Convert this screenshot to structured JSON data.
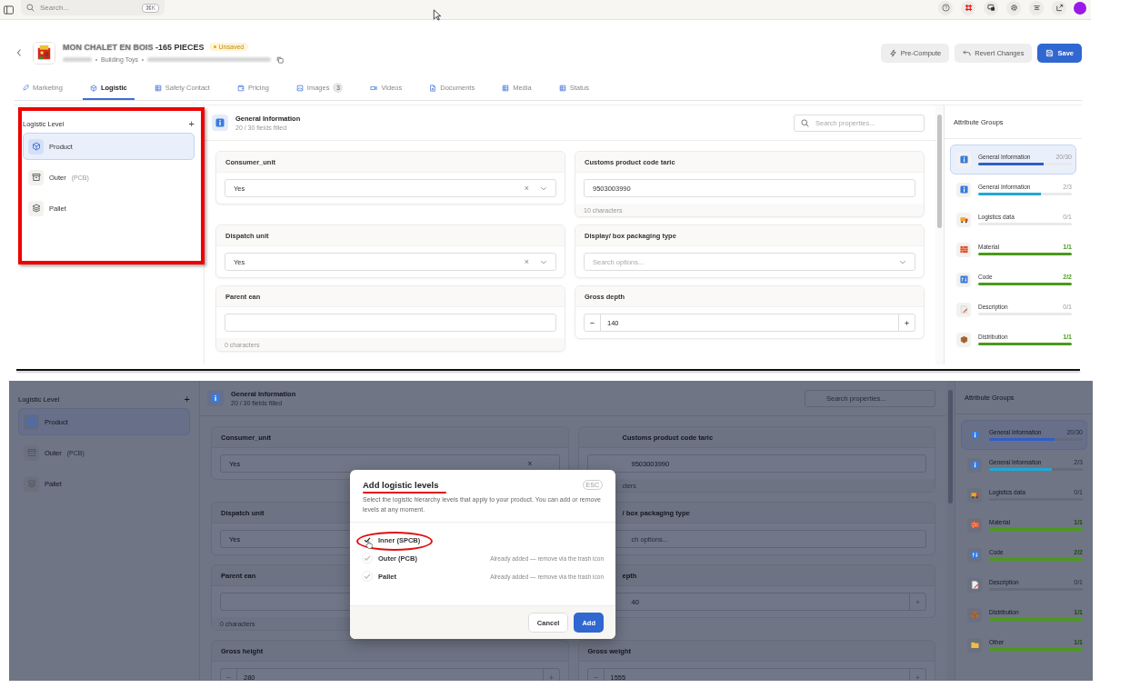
{
  "topbar": {
    "search_placeholder": "Search...",
    "shortcut": "⌘K"
  },
  "product": {
    "title_blurred": "MON CHALET EN BOIS",
    "title": " -165 PIECES",
    "status": "Unsaved",
    "category": "Building Toys"
  },
  "actions": [
    {
      "label": "Pre-Compute",
      "kind": "secondary"
    },
    {
      "label": "Revert Changes",
      "kind": "secondary"
    },
    {
      "label": "Save",
      "kind": "primary"
    }
  ],
  "tabs": [
    {
      "label": "Marketing",
      "selected": false
    },
    {
      "label": "Logistic",
      "selected": true
    },
    {
      "label": "Safety Contact",
      "selected": false
    },
    {
      "label": "Pricing",
      "selected": false
    },
    {
      "label": "Images",
      "selected": false,
      "count": "3"
    },
    {
      "label": "Videos",
      "selected": false
    },
    {
      "label": "Documents",
      "selected": false
    },
    {
      "label": "Media",
      "selected": false
    },
    {
      "label": "Status",
      "selected": false
    }
  ],
  "views": [
    {
      "dimmed": false,
      "logistic_panel": {
        "title": "Logistic Level",
        "add": "+",
        "levels": [
          {
            "name": "Product",
            "selected": true
          },
          {
            "name": "Outer",
            "tag": "(PCB)",
            "selected": false
          },
          {
            "name": "Pallet",
            "selected": false
          }
        ]
      },
      "section": {
        "title": "General Information",
        "progress": "20 / 30 fields filled",
        "search_placeholder": "Search properties..."
      },
      "fields": [
        {
          "label": "Consumer_unit",
          "kind": "select",
          "value": "Yes",
          "clear": "×"
        },
        {
          "label": "Customs product code taric",
          "kind": "text",
          "value": "9503003990",
          "hint": "10 characters"
        },
        {
          "label": "Dispatch unit",
          "kind": "select",
          "value": "Yes",
          "clear": "×"
        },
        {
          "label": "Display/ box packaging type",
          "kind": "search-select",
          "placeholder": "Search options..."
        },
        {
          "label": "Parent ean",
          "kind": "text",
          "hint": "0 characters"
        },
        {
          "label": "Gross depth",
          "kind": "stepper",
          "value": "140"
        }
      ],
      "attribute_groups": {
        "title": "Attribute Groups",
        "groups": [
          {
            "name": "General Information",
            "count": "20/30",
            "level": 0.7,
            "color": "#2f5fc4",
            "selected": true
          },
          {
            "name": "General Information",
            "count": "2/3",
            "level": 0.67,
            "color": "#1fa8d6",
            "selected": false
          },
          {
            "name": "Logistics data",
            "count": "0/1",
            "selected": false
          },
          {
            "name": "Material",
            "count": "1/1",
            "level": 1,
            "color": "#4a9a1a",
            "selected": false
          },
          {
            "name": "Code",
            "count": "2/2",
            "level": 1,
            "color": "#4a9a1a",
            "selected": false
          },
          {
            "name": "Description",
            "count": "0/1",
            "selected": false
          },
          {
            "name": "Distribution",
            "count": "1/1",
            "level": 1,
            "color": "#4a9a1a",
            "selected": false
          }
        ]
      }
    },
    {
      "dimmed": true,
      "logistic_panel": {
        "title": "Logistic Level",
        "add": "+",
        "levels": [
          {
            "name": "Product",
            "selected": true
          },
          {
            "name": "Outer",
            "tag": "(PCB)",
            "selected": false
          },
          {
            "name": "Pallet",
            "selected": false
          }
        ]
      },
      "section": {
        "title": "General Information",
        "progress": "20 / 30 fields filled",
        "search_placeholder": "Search properties..."
      },
      "fields": [
        {
          "label": "Consumer_unit",
          "kind": "select",
          "value": "Yes",
          "clear": "×"
        },
        {
          "label": "Customs product code taric",
          "kind": "text",
          "value": "9503003990",
          "hint": "cters",
          "covered": true
        },
        {
          "label": "Dispatch unit",
          "kind": "select",
          "value": "Yes"
        },
        {
          "label": "/ box packaging type",
          "kind": "search-select",
          "placeholder": "ch options...",
          "covered": true
        },
        {
          "label": "Parent ean",
          "kind": "text",
          "hint": "0 characters"
        },
        {
          "label": "epth",
          "kind": "stepper",
          "value": "40",
          "covered": true
        },
        {
          "label": "Gross height",
          "kind": "stepper",
          "value": "280"
        },
        {
          "label": "Gross weight",
          "kind": "stepper",
          "value": "1555"
        }
      ],
      "attribute_groups": {
        "title": "Attribute Groups",
        "groups": [
          {
            "name": "General Information",
            "count": "20/30",
            "level": 0.7,
            "color": "#2f5fc4",
            "selected": true
          },
          {
            "name": "General Information",
            "count": "2/3",
            "level": 0.67,
            "color": "#1fa8d6",
            "selected": false
          },
          {
            "name": "Logistics data",
            "count": "0/1",
            "selected": false
          },
          {
            "name": "Material",
            "count": "1/1",
            "level": 1,
            "color": "#4a9a1a",
            "selected": false
          },
          {
            "name": "Code",
            "count": "2/2",
            "level": 1,
            "color": "#4a9a1a",
            "selected": false
          },
          {
            "name": "Description",
            "count": "0/1",
            "selected": false
          },
          {
            "name": "Distribution",
            "count": "1/1",
            "level": 1,
            "color": "#4a9a1a",
            "selected": false
          },
          {
            "name": "Other",
            "count": "1/1",
            "level": 1,
            "color": "#4a9a1a",
            "selected": false
          }
        ]
      },
      "dialog": {
        "title": "Add logistic levels",
        "esc": "ESC",
        "description": "Select the logistic hierarchy levels that apply to your product. You can add or remove levels at any moment.",
        "options": [
          {
            "label": "Inner (SPCB)",
            "checked": true,
            "disabled": false
          },
          {
            "label": "Outer (PCB)",
            "checked": true,
            "disabled": true,
            "note": "Already added — remove via the trash icon"
          },
          {
            "label": "Pallet",
            "checked": true,
            "disabled": true,
            "note": "Already added — remove via the trash icon"
          }
        ],
        "buttons": [
          {
            "label": "Cancel",
            "kind": "secondary"
          },
          {
            "label": "Add",
            "kind": "primary"
          }
        ]
      }
    }
  ]
}
